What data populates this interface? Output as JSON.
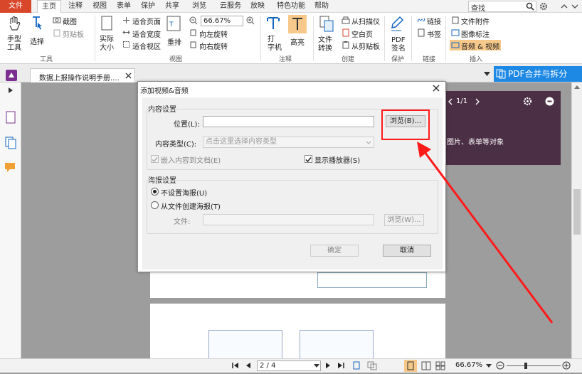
{
  "menubar": {
    "items": [
      "文件",
      "主页",
      "注释",
      "视图",
      "表单",
      "保护",
      "共享",
      "浏览",
      "云服务",
      "放映",
      "特色功能",
      "帮助"
    ],
    "search_label": "查找"
  },
  "ribbon": {
    "hand_tool": "手型\n工具",
    "select": "选择",
    "screenshot": "截图",
    "clipboard": "剪贴板",
    "actual_size": "实际\n大小",
    "fit_page": "适合页面",
    "fit_width": "适合宽度",
    "fit_visible": "适合视区",
    "reflow": "重排",
    "zoom_value": "66.67%",
    "rotate_left": "向左旋转",
    "rotate_right": "向右旋转",
    "typewriter": "打\n字机",
    "highlight": "高亮",
    "file_convert": "文件\n转换",
    "from_scanner": "从扫描仪",
    "blank_page": "空白页",
    "from_clipboard": "从剪贴板",
    "pdf_sign": "PDF\n签名",
    "link": "链接",
    "bookmark": "书签",
    "file_attachment": "文件附件",
    "image_annotation": "图像标注",
    "audio_video": "音频 & 视频",
    "groups": {
      "tools": "工具",
      "view": "视图",
      "comment": "注释",
      "create": "创建",
      "protect": "保护",
      "links": "链接",
      "insert": "插入"
    }
  },
  "tabs": {
    "doc_title": "数据上报操作说明手册....",
    "pdf_merge": "PDF合并与拆分"
  },
  "dialog": {
    "title": "添加视频&音频",
    "content_section": "内容设置",
    "location_label": "位置(L):",
    "location_value": "",
    "browse_button": "浏览(B)...",
    "content_type_label": "内容类型(C):",
    "content_type_placeholder": "点击这里选择内容类型",
    "embed_label": "嵌入内容到文档(E)",
    "embed_checked": true,
    "show_player_label": "显示播放器(S)",
    "show_player_checked": true,
    "poster_section": "海报设置",
    "no_poster": "不设置海报(U)",
    "poster_from_file": "从文件创建海报(T)",
    "file_label": "文件:",
    "browse_w": "浏览(W)...",
    "ok": "确定",
    "cancel": "取消"
  },
  "side_panel": {
    "page_indicator": "1/1",
    "text": "图片、表单等对象"
  },
  "statusbar": {
    "page_value": "2 / 4",
    "zoom": "66.67%"
  },
  "colors": {
    "accent_red": "#d9472b",
    "pdf_blue": "#1e88e5",
    "purple_panel": "#4b2f45",
    "annotation_red": "#ff1a1a"
  }
}
